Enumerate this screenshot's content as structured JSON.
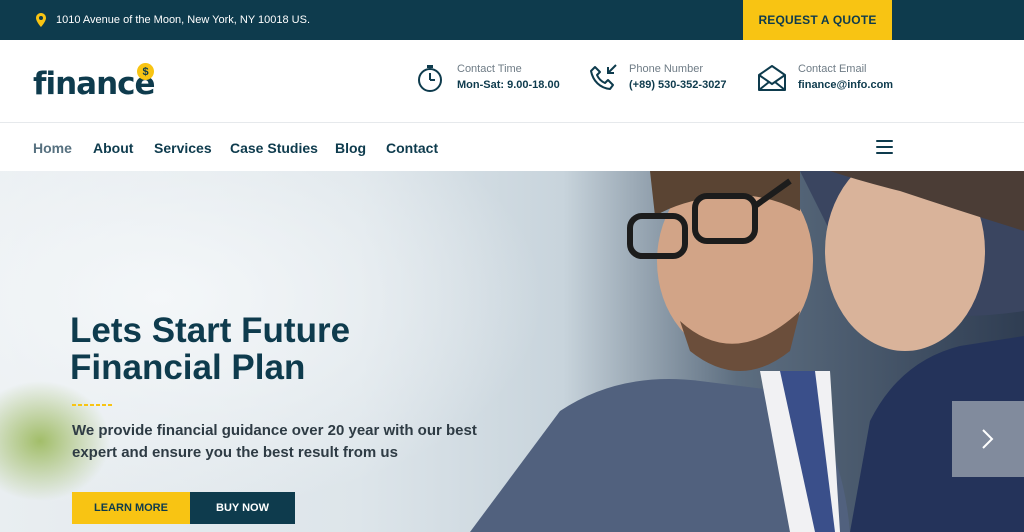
{
  "topbar": {
    "address": "1010 Avenue of the Moon, New York, NY 10018 US.",
    "quote_button": "REQUEST A QUOTE"
  },
  "header": {
    "logo_text": "finance",
    "logo_badge": "$",
    "contacts": [
      {
        "icon": "stopwatch-icon",
        "label": "Contact Time",
        "value": "Mon-Sat: 9.00-18.00"
      },
      {
        "icon": "phone-icon",
        "label": "Phone Number",
        "value": "(+89) 530-352-3027"
      },
      {
        "icon": "envelope-icon",
        "label": "Contact Email",
        "value": "finance@info.com"
      }
    ]
  },
  "nav": {
    "items": [
      {
        "label": "Home",
        "active": true
      },
      {
        "label": "About"
      },
      {
        "label": "Services"
      },
      {
        "label": "Case Studies"
      },
      {
        "label": "Blog"
      },
      {
        "label": "Contact"
      }
    ],
    "menu_icon": "hamburger-menu-icon"
  },
  "hero": {
    "title_line1": "Lets Start Future",
    "title_line2": "Financial Plan",
    "description": "We provide financial guidance over 20 year with our best expert and ensure you the best result from us",
    "learn_more": "LEARN MORE",
    "buy_now": "BUY NOW",
    "next_icon": "chevron-right-icon"
  },
  "colors": {
    "navy": "#0e3b4d",
    "accent_yellow": "#f8c413",
    "muted_text": "#6f7c86"
  }
}
